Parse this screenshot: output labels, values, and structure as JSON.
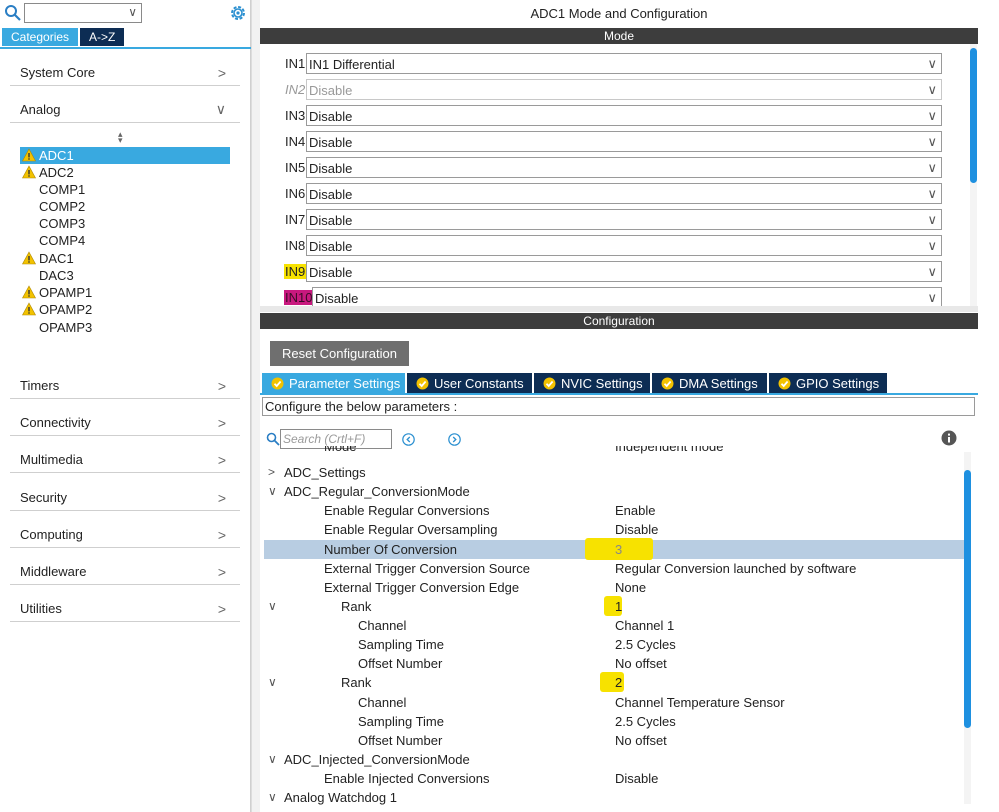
{
  "left_panel": {
    "search_value": "",
    "tab_categories": "Categories",
    "tab_az": "A->Z",
    "categories": [
      {
        "label": "System Core",
        "arrow": ">"
      },
      {
        "label": "Analog",
        "arrow": "∨"
      },
      {
        "label": "Timers",
        "arrow": ">"
      },
      {
        "label": "Connectivity",
        "arrow": ">"
      },
      {
        "label": "Multimedia",
        "arrow": ">"
      },
      {
        "label": "Security",
        "arrow": ">"
      },
      {
        "label": "Computing",
        "arrow": ">"
      },
      {
        "label": "Middleware",
        "arrow": ">"
      },
      {
        "label": "Utilities",
        "arrow": ">"
      }
    ],
    "analog_items": [
      {
        "label": "ADC1",
        "warning": true,
        "selected": true
      },
      {
        "label": "ADC2",
        "warning": true,
        "selected": false
      },
      {
        "label": "COMP1",
        "warning": false,
        "selected": false
      },
      {
        "label": "COMP2",
        "warning": false,
        "selected": false
      },
      {
        "label": "COMP3",
        "warning": false,
        "selected": false
      },
      {
        "label": "COMP4",
        "warning": false,
        "selected": false
      },
      {
        "label": "DAC1",
        "warning": true,
        "selected": false
      },
      {
        "label": "DAC3",
        "warning": false,
        "selected": false
      },
      {
        "label": "OPAMP1",
        "warning": true,
        "selected": false
      },
      {
        "label": "OPAMP2",
        "warning": true,
        "selected": false
      },
      {
        "label": "OPAMP3",
        "warning": false,
        "selected": false
      }
    ]
  },
  "main": {
    "title": "ADC1 Mode and Configuration",
    "mode_header": "Mode",
    "mode_rows": [
      {
        "label": "IN1",
        "value": "IN1 Differential",
        "disabled": false,
        "highlight": ""
      },
      {
        "label": "IN2",
        "value": "Disable",
        "disabled": true,
        "highlight": ""
      },
      {
        "label": "IN3",
        "value": "Disable",
        "disabled": false,
        "highlight": ""
      },
      {
        "label": "IN4",
        "value": "Disable",
        "disabled": false,
        "highlight": ""
      },
      {
        "label": "IN5",
        "value": "Disable",
        "disabled": false,
        "highlight": ""
      },
      {
        "label": "IN6",
        "value": "Disable",
        "disabled": false,
        "highlight": ""
      },
      {
        "label": "IN7",
        "value": "Disable",
        "disabled": false,
        "highlight": ""
      },
      {
        "label": "IN8",
        "value": "Disable",
        "disabled": false,
        "highlight": ""
      },
      {
        "label": "IN9",
        "value": "Disable",
        "disabled": false,
        "highlight": "yellow"
      },
      {
        "label": "IN10",
        "value": "Disable",
        "disabled": false,
        "highlight": "magenta"
      }
    ],
    "config_header": "Configuration",
    "reset_button": "Reset Configuration",
    "config_tabs": [
      {
        "label": "Parameter Settings",
        "active": true
      },
      {
        "label": "User Constants",
        "active": false
      },
      {
        "label": "NVIC Settings",
        "active": false
      },
      {
        "label": "DMA Settings",
        "active": false
      },
      {
        "label": "GPIO Settings",
        "active": false
      }
    ],
    "configure_text": "Configure the below parameters :",
    "search_placeholder": "Search (Crtl+F)",
    "params": [
      {
        "name": "Mode",
        "value": "Independent mode",
        "level": 2,
        "toggle": ""
      },
      {
        "name": "ADC_Settings",
        "value": "",
        "level": 1,
        "toggle": ">"
      },
      {
        "name": "ADC_Regular_ConversionMode",
        "value": "",
        "level": 1,
        "toggle": "∨"
      },
      {
        "name": "Enable Regular Conversions",
        "value": "Enable",
        "level": 2,
        "toggle": ""
      },
      {
        "name": "Enable Regular Oversampling",
        "value": "Disable",
        "level": 2,
        "toggle": ""
      },
      {
        "name": "Number Of Conversion",
        "value": "3",
        "level": 2,
        "toggle": "",
        "selected": true
      },
      {
        "name": "External Trigger Conversion Source",
        "value": "Regular Conversion launched by software",
        "level": 2,
        "toggle": ""
      },
      {
        "name": "External Trigger Conversion Edge",
        "value": "None",
        "level": 2,
        "toggle": ""
      },
      {
        "name": "Rank",
        "value": "1",
        "level": 3,
        "toggle": "∨"
      },
      {
        "name": "Channel",
        "value": "Channel 1",
        "level": 4,
        "toggle": ""
      },
      {
        "name": "Sampling Time",
        "value": "2.5 Cycles",
        "level": 4,
        "toggle": ""
      },
      {
        "name": "Offset Number",
        "value": "No offset",
        "level": 4,
        "toggle": ""
      },
      {
        "name": "Rank",
        "value": "2",
        "level": 3,
        "toggle": "∨"
      },
      {
        "name": "Channel",
        "value": "Channel Temperature Sensor",
        "level": 4,
        "toggle": ""
      },
      {
        "name": "Sampling Time",
        "value": "2.5 Cycles",
        "level": 4,
        "toggle": ""
      },
      {
        "name": "Offset Number",
        "value": "No offset",
        "level": 4,
        "toggle": ""
      },
      {
        "name": "ADC_Injected_ConversionMode",
        "value": "",
        "level": 1,
        "toggle": "∨"
      },
      {
        "name": "Enable Injected Conversions",
        "value": "Disable",
        "level": 2,
        "toggle": ""
      },
      {
        "name": "Analog Watchdog 1",
        "value": "",
        "level": 1,
        "toggle": "∨"
      }
    ]
  },
  "colors": {
    "accent": "#39a9e0",
    "dark_navy": "#0d2d54",
    "header_bar": "#3d3d3d",
    "highlight_yellow": "#f7e200",
    "highlight_magenta": "#c8187e",
    "selected_row": "#b8cde2",
    "warning": "#f2c200"
  },
  "icons": {
    "search": "search-icon",
    "settings": "gear-icon",
    "warning": "warning-icon",
    "check": "check-circle-icon",
    "info": "info-icon",
    "prev": "prev-circle-icon",
    "next": "next-circle-icon"
  }
}
